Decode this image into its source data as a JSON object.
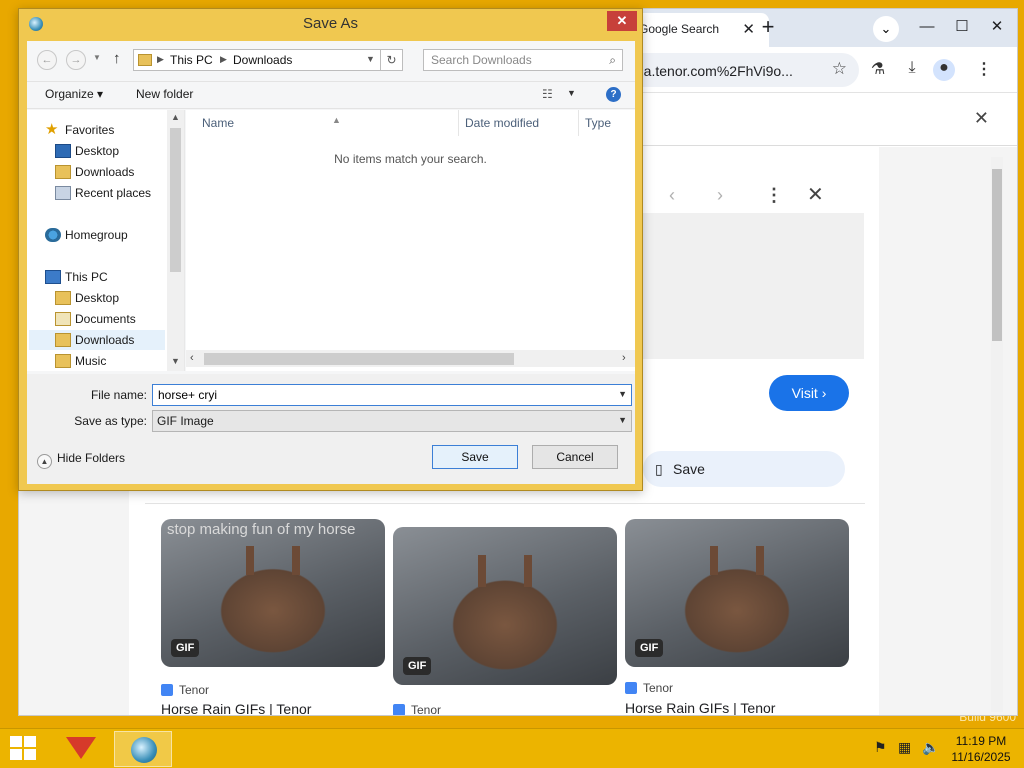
{
  "desktop": {
    "watermark": "Build 9600"
  },
  "browser": {
    "tab_label": "Google Search",
    "tab_close": "✕",
    "new_tab": "+",
    "url_partial": "edia.tenor.com%2FhVi9o...",
    "side_panel": {
      "visit_label": "Visit ›",
      "save_label": "Save",
      "results": [
        {
          "caption": "stop making fun of my horse",
          "badge": "GIF",
          "source": "Tenor",
          "title": "Horse Rain GIFs | Tenor"
        },
        {
          "caption": "",
          "badge": "GIF",
          "source": "Tenor",
          "title": ""
        },
        {
          "caption": "",
          "badge": "GIF",
          "source": "Tenor",
          "title": "Horse Rain GIFs | Tenor"
        }
      ]
    }
  },
  "dialog": {
    "title": "Save As",
    "address": {
      "crumbs": [
        "This PC",
        "Downloads"
      ]
    },
    "search_placeholder": "Search Downloads",
    "commands": {
      "organize": "Organize ▾",
      "new_folder": "New folder"
    },
    "nav_tree": [
      {
        "label": "Favorites",
        "icon": "star-icon"
      },
      {
        "label": "Desktop",
        "icon": "desktop-icon"
      },
      {
        "label": "Downloads",
        "icon": "downloads-folder-icon"
      },
      {
        "label": "Recent places",
        "icon": "recent-places-icon"
      },
      {
        "label": "Homegroup",
        "icon": "homegroup-icon"
      },
      {
        "label": "This PC",
        "icon": "computer-icon"
      },
      {
        "label": "Desktop",
        "icon": "desktop-icon"
      },
      {
        "label": "Documents",
        "icon": "documents-icon"
      },
      {
        "label": "Downloads",
        "icon": "downloads-folder-icon",
        "selected": true
      },
      {
        "label": "Music",
        "icon": "music-folder-icon"
      }
    ],
    "columns": [
      "Name",
      "Date modified",
      "Type"
    ],
    "empty_message": "No items match your search.",
    "file_name_label": "File name:",
    "file_name_value": "horse+ cryi",
    "save_as_type_label": "Save as type:",
    "save_as_type_value": "GIF Image",
    "hide_folders_label": "Hide Folders",
    "save_button": "Save",
    "cancel_button": "Cancel"
  },
  "taskbar": {
    "time": "11:19 PM",
    "date": "11/16/2025"
  },
  "colors": {
    "accent": "#1a73e8",
    "desktop": "#e8a800",
    "dialog_frame": "#f0c850",
    "close_red": "#c7403a"
  }
}
